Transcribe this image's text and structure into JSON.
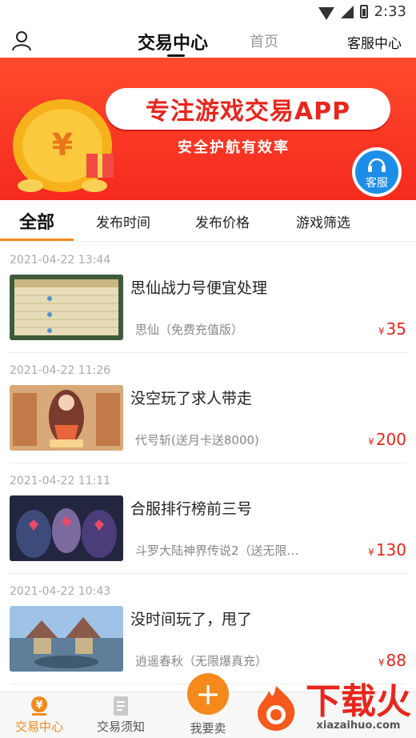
{
  "status": {
    "time": "2:33"
  },
  "nav": {
    "trade_center": "交易中心",
    "home": "首页",
    "service_center": "客服中心"
  },
  "banner": {
    "title": "专注游戏交易APP",
    "subtitle": "安全护航有效率",
    "service_label": "客服"
  },
  "filters": {
    "all": "全部",
    "time": "发布时间",
    "price": "发布价格",
    "game": "游戏筛选"
  },
  "currency": "¥",
  "items": [
    {
      "date": "2021-04-22 13:44",
      "title": "思仙战力号便宜处理",
      "game": "思仙（免费充值版）",
      "price": "35"
    },
    {
      "date": "2021-04-22 11:26",
      "title": "没空玩了求人带走",
      "game": "代号斩(送月卡送8000)",
      "price": "200"
    },
    {
      "date": "2021-04-22 11:11",
      "title": "合服排行榜前三号",
      "game": "斗罗大陆神界传说2（送无限…",
      "price": "130"
    },
    {
      "date": "2021-04-22 10:43",
      "title": "没时间玩了，甩了",
      "game": "逍遥春秋（无限爆真充）",
      "price": "88"
    }
  ],
  "bottom": {
    "trade_center": "交易中心",
    "notice": "交易须知",
    "sell": "我要卖"
  },
  "watermark": {
    "cn": "下载火",
    "url": "xiazaihuo.com"
  },
  "colors": {
    "accent": "#f5891c",
    "banner": "#f52a1e",
    "price": "#e8261d"
  }
}
